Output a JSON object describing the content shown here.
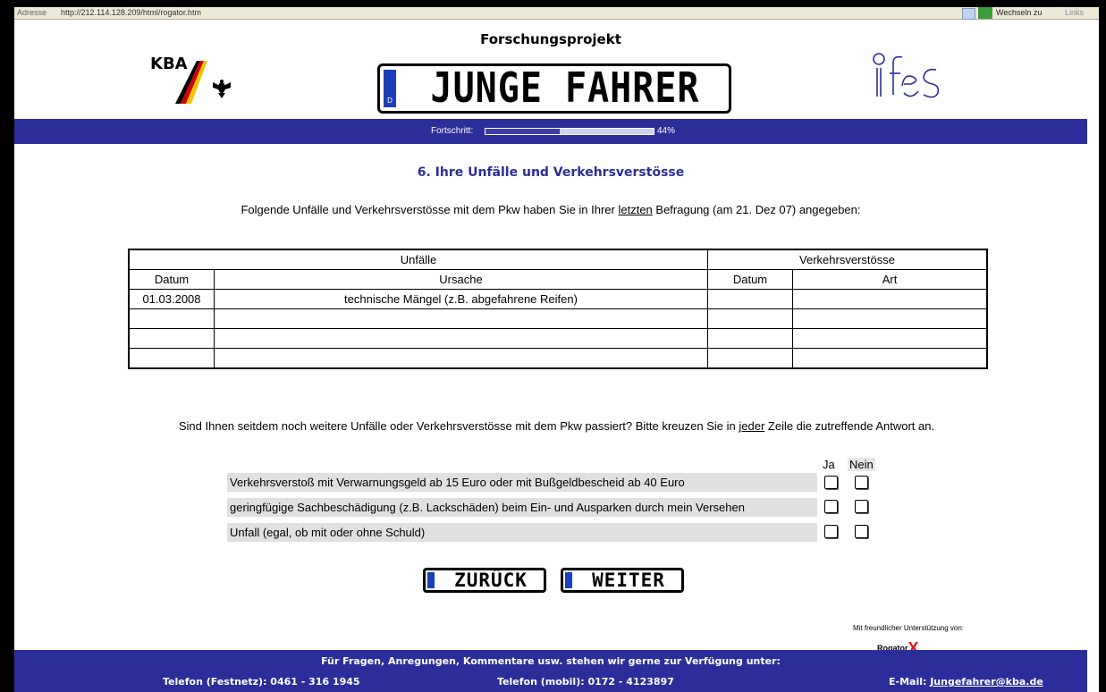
{
  "browser": {
    "address_label": "Adresse",
    "url": "http://212.114.128.209/html/rogator.htm",
    "go_label": "Wechseln zu",
    "links_label": "Links"
  },
  "header": {
    "title": "Forschungsprojekt",
    "kba_logo_text": "KBA",
    "plate_text": "JUNGE FAHRER",
    "plate_country": "D",
    "ifes_logo_text": "ifes"
  },
  "progress": {
    "label": "Fortschritt:",
    "value": 0.44,
    "percent_text": "44%"
  },
  "section": {
    "title": "6. Ihre Unfälle und Verkehrsverstösse",
    "intro_before": "Folgende Unfälle und Verkehrsverstösse mit dem Pkw haben Sie in Ihrer ",
    "intro_underlined": "letzten",
    "intro_after": " Befragung (am 21. Dez 07) angegeben:"
  },
  "table": {
    "group_headers": [
      "Unfälle",
      "Verkehrsverstösse"
    ],
    "columns": [
      "Datum",
      "Ursache",
      "Datum",
      "Art"
    ],
    "rows": [
      [
        "01.03.2008",
        "technische Mängel (z.B. abgefahrene Reifen)",
        "",
        ""
      ],
      [
        "",
        "",
        "",
        ""
      ],
      [
        "",
        "",
        "",
        ""
      ],
      [
        "",
        "",
        "",
        ""
      ]
    ]
  },
  "question": {
    "before": "Sind Ihnen seitdem noch weitere Unfälle oder Verkehrsverstösse mit dem Pkw passiert? Bitte kreuzen Sie in ",
    "underlined": "jeder",
    "after": " Zeile die zutreffende Antwort an.",
    "ja_label": "Ja",
    "nein_label": "Nein",
    "items": [
      "Verkehrsverstoß mit Verwarnungsgeld ab 15 Euro oder mit Bußgeldbescheid ab 40 Euro",
      "geringfügige Sachbeschädigung (z.B. Lackschäden) beim Ein- und Ausparken durch mein Versehen",
      "Unfall (egal, ob mit oder ohne Schuld)"
    ]
  },
  "nav": {
    "back_label": "ZURÜCK",
    "next_label": "WEITER"
  },
  "support": {
    "text": "Mit freundlicher Unterstützung von:",
    "brand": "Rogator",
    "brand_mark": "X"
  },
  "footer": {
    "line1": "Für Fragen, Anregungen, Kommentare usw. stehen wir gerne zur Verfügung unter:",
    "tel_fest": "Telefon (Festnetz): 0461 - 316 1945",
    "tel_mobil": "Telefon (mobil): 0172 - 4123897",
    "email_label": "E-Mail: ",
    "email": "Jungefahrer@kba.de"
  },
  "colors": {
    "brand_blue": "#2b2e9a",
    "plate_blue": "#1b3fb8",
    "row_gray": "#e0e0e0"
  }
}
